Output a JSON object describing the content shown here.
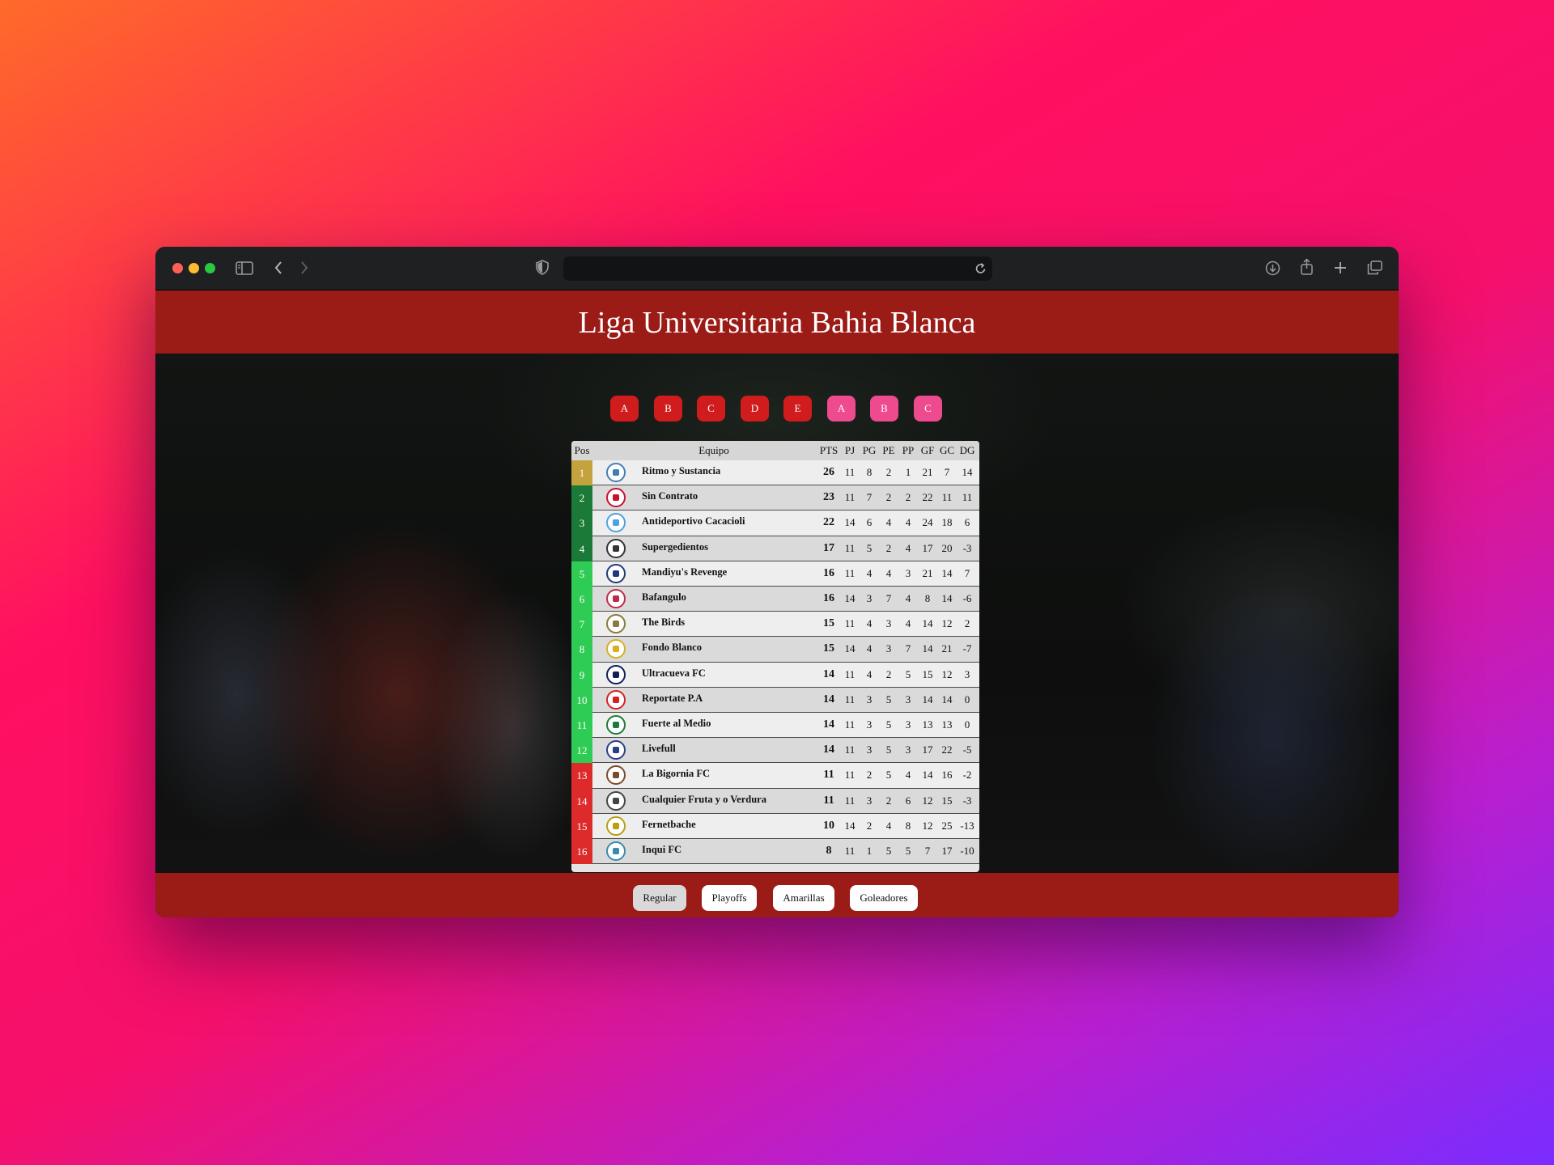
{
  "page": {
    "title": "Liga Universitaria Bahia Blanca"
  },
  "browser": {
    "url": ""
  },
  "colors": {
    "header_red": "#9b1b17",
    "tab_red": "#d01c1c",
    "tab_pink": "#ee4a8e",
    "pos_gold": "#c3a33d",
    "pos_darkgreen": "#1c7a38",
    "pos_green": "#2ecc55",
    "pos_red": "#dd2b2b"
  },
  "group_tabs": [
    {
      "label": "A",
      "style": "red"
    },
    {
      "label": "B",
      "style": "red"
    },
    {
      "label": "C",
      "style": "red"
    },
    {
      "label": "D",
      "style": "red"
    },
    {
      "label": "E",
      "style": "red"
    },
    {
      "label": "A",
      "style": "pink"
    },
    {
      "label": "B",
      "style": "pink"
    },
    {
      "label": "C",
      "style": "pink"
    }
  ],
  "table": {
    "headers": {
      "pos": "Pos",
      "team": "Equipo",
      "pts": "PTS",
      "pj": "PJ",
      "pg": "PG",
      "pe": "PE",
      "pp": "PP",
      "gf": "GF",
      "gc": "GC",
      "dg": "DG"
    },
    "rows": [
      {
        "pos": "1",
        "zone": "gold",
        "crest": "#3e7fb8",
        "team": "Ritmo y Sustancia",
        "pts": "26",
        "pj": "11",
        "pg": "8",
        "pe": "2",
        "pp": "1",
        "gf": "21",
        "gc": "7",
        "dg": "14"
      },
      {
        "pos": "2",
        "zone": "darkgreen",
        "crest": "#c8102e",
        "team": "Sin Contrato",
        "pts": "23",
        "pj": "11",
        "pg": "7",
        "pe": "2",
        "pp": "2",
        "gf": "22",
        "gc": "11",
        "dg": "11"
      },
      {
        "pos": "3",
        "zone": "darkgreen",
        "crest": "#4aa3df",
        "team": "Antideportivo Cacacioli",
        "pts": "22",
        "pj": "14",
        "pg": "6",
        "pe": "4",
        "pp": "4",
        "gf": "24",
        "gc": "18",
        "dg": "6"
      },
      {
        "pos": "4",
        "zone": "darkgreen",
        "crest": "#333333",
        "team": "Supergedientos",
        "pts": "17",
        "pj": "11",
        "pg": "5",
        "pe": "2",
        "pp": "4",
        "gf": "17",
        "gc": "20",
        "dg": "-3"
      },
      {
        "pos": "5",
        "zone": "green",
        "crest": "#1f3a7a",
        "team": "Mandiyu's Revenge",
        "pts": "16",
        "pj": "11",
        "pg": "4",
        "pe": "4",
        "pp": "3",
        "gf": "21",
        "gc": "14",
        "dg": "7"
      },
      {
        "pos": "6",
        "zone": "green",
        "crest": "#c02a4a",
        "team": "Bafangulo",
        "pts": "16",
        "pj": "14",
        "pg": "3",
        "pe": "7",
        "pp": "4",
        "gf": "8",
        "gc": "14",
        "dg": "-6"
      },
      {
        "pos": "7",
        "zone": "green",
        "crest": "#8a7a3a",
        "team": "The Birds",
        "pts": "15",
        "pj": "11",
        "pg": "4",
        "pe": "3",
        "pp": "4",
        "gf": "14",
        "gc": "12",
        "dg": "2"
      },
      {
        "pos": "8",
        "zone": "green",
        "crest": "#d8b020",
        "team": "Fondo Blanco",
        "pts": "15",
        "pj": "14",
        "pg": "4",
        "pe": "3",
        "pp": "7",
        "gf": "14",
        "gc": "21",
        "dg": "-7"
      },
      {
        "pos": "9",
        "zone": "green",
        "crest": "#0f1f5a",
        "team": "Ultracueva FC",
        "pts": "14",
        "pj": "11",
        "pg": "4",
        "pe": "2",
        "pp": "5",
        "gf": "15",
        "gc": "12",
        "dg": "3"
      },
      {
        "pos": "10",
        "zone": "green",
        "crest": "#d62020",
        "team": "Reportate P.A",
        "pts": "14",
        "pj": "11",
        "pg": "3",
        "pe": "5",
        "pp": "3",
        "gf": "14",
        "gc": "14",
        "dg": "0"
      },
      {
        "pos": "11",
        "zone": "green",
        "crest": "#1f7a3a",
        "team": "Fuerte al Medio",
        "pts": "14",
        "pj": "11",
        "pg": "3",
        "pe": "5",
        "pp": "3",
        "gf": "13",
        "gc": "13",
        "dg": "0"
      },
      {
        "pos": "12",
        "zone": "green",
        "crest": "#2a3f8a",
        "team": "Livefull",
        "pts": "14",
        "pj": "11",
        "pg": "3",
        "pe": "5",
        "pp": "3",
        "gf": "17",
        "gc": "22",
        "dg": "-5"
      },
      {
        "pos": "13",
        "zone": "red",
        "crest": "#7a4a2a",
        "team": "La Bigornia FC",
        "pts": "11",
        "pj": "11",
        "pg": "2",
        "pe": "5",
        "pp": "4",
        "gf": "14",
        "gc": "16",
        "dg": "-2"
      },
      {
        "pos": "14",
        "zone": "red",
        "crest": "#444444",
        "team": "Cualquier Fruta y o Verdura",
        "pts": "11",
        "pj": "11",
        "pg": "3",
        "pe": "2",
        "pp": "6",
        "gf": "12",
        "gc": "15",
        "dg": "-3"
      },
      {
        "pos": "15",
        "zone": "red",
        "crest": "#b8a010",
        "team": "Fernetbache",
        "pts": "10",
        "pj": "14",
        "pg": "2",
        "pe": "4",
        "pp": "8",
        "gf": "12",
        "gc": "25",
        "dg": "-13"
      },
      {
        "pos": "16",
        "zone": "red",
        "crest": "#3a8ab0",
        "team": "Inqui FC",
        "pts": "8",
        "pj": "11",
        "pg": "1",
        "pe": "5",
        "pp": "5",
        "gf": "7",
        "gc": "17",
        "dg": "-10"
      }
    ]
  },
  "footer_nav": [
    {
      "label": "Regular",
      "active": true
    },
    {
      "label": "Playoffs",
      "active": false
    },
    {
      "label": "Amarillas",
      "active": false
    },
    {
      "label": "Goleadores",
      "active": false
    }
  ]
}
